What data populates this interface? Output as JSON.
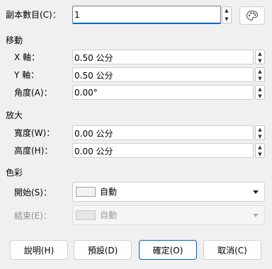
{
  "copies": {
    "label": "副本數目(C)：",
    "value": "1"
  },
  "move": {
    "section": "移動",
    "x": {
      "label": "X 軸：",
      "value": "0.50 公分"
    },
    "y": {
      "label": "Y 軸：",
      "value": "0.50 公分"
    },
    "angle": {
      "label": "角度(A)：",
      "value": "0.00°"
    }
  },
  "enlarge": {
    "section": "放大",
    "width": {
      "label": "寬度(W)：",
      "value": "0.00 公分"
    },
    "height": {
      "label": "高度(H)：",
      "value": "0.00 公分"
    }
  },
  "color": {
    "section": "色彩",
    "start": {
      "label": "開始(S)：",
      "value": "自動"
    },
    "end": {
      "label": "結束(E)：",
      "value": "自動"
    }
  },
  "buttons": {
    "help": "說明(H)",
    "defaults": "預設(D)",
    "ok": "確定(O)",
    "cancel": "取消(C)"
  },
  "icons": {
    "spin_up": "▲",
    "spin_down": "▼",
    "palette": "palette-icon"
  }
}
